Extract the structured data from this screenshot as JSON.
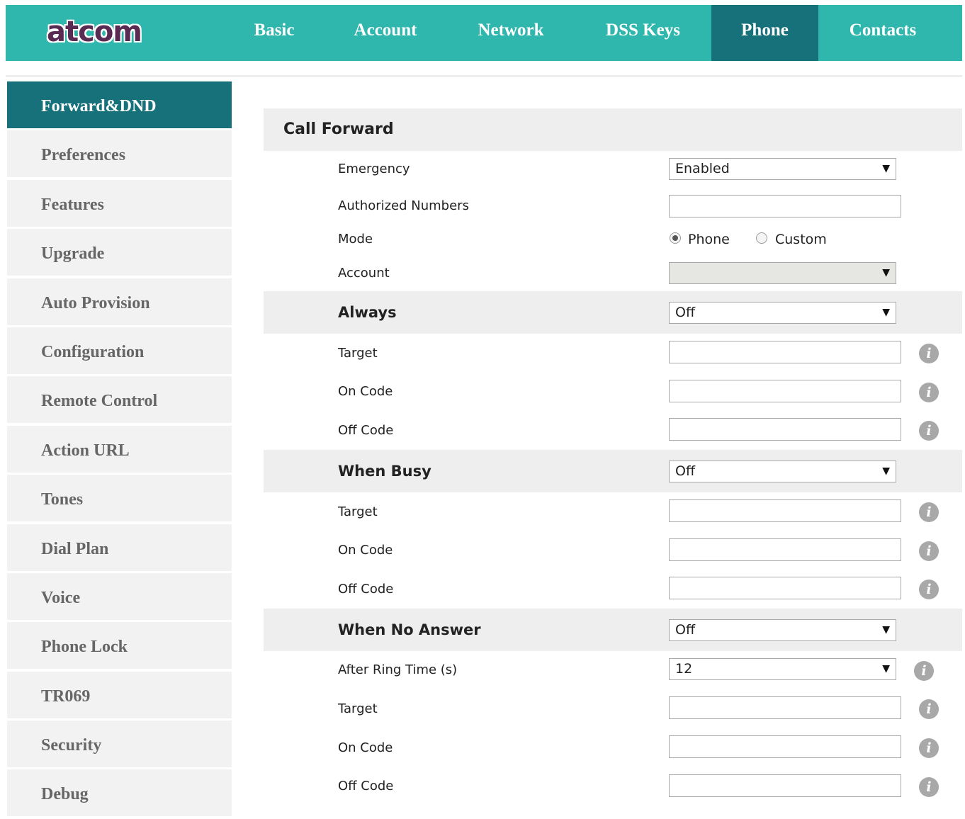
{
  "brand": {
    "logo_text": "atcom"
  },
  "nav": {
    "items": [
      {
        "label": "Basic"
      },
      {
        "label": "Account"
      },
      {
        "label": "Network"
      },
      {
        "label": "DSS Keys"
      },
      {
        "label": "Phone",
        "active": true
      },
      {
        "label": "Contacts"
      }
    ]
  },
  "sidebar": {
    "items": [
      {
        "label": "Forward&DND",
        "active": true
      },
      {
        "label": "Preferences"
      },
      {
        "label": "Features"
      },
      {
        "label": "Upgrade"
      },
      {
        "label": "Auto Provision"
      },
      {
        "label": "Configuration"
      },
      {
        "label": "Remote Control"
      },
      {
        "label": "Action URL"
      },
      {
        "label": "Tones"
      },
      {
        "label": "Dial Plan"
      },
      {
        "label": "Voice"
      },
      {
        "label": "Phone Lock"
      },
      {
        "label": "TR069"
      },
      {
        "label": "Security"
      },
      {
        "label": "Debug"
      }
    ]
  },
  "call_forward": {
    "title": "Call Forward",
    "emergency": {
      "label": "Emergency",
      "value": "Enabled"
    },
    "authorized_numbers": {
      "label": "Authorized Numbers",
      "value": ""
    },
    "mode": {
      "label": "Mode",
      "options": [
        "Phone",
        "Custom"
      ],
      "selected": "Phone"
    },
    "account": {
      "label": "Account",
      "value": ""
    },
    "always": {
      "label": "Always",
      "value": "Off",
      "target_label": "Target",
      "on_code_label": "On Code",
      "off_code_label": "Off Code"
    },
    "when_busy": {
      "label": "When Busy",
      "value": "Off",
      "target_label": "Target",
      "on_code_label": "On Code",
      "off_code_label": "Off Code"
    },
    "when_no_answer": {
      "label": "When No Answer",
      "value": "Off",
      "ring_time_label": "After Ring Time (s)",
      "ring_time_value": "12",
      "target_label": "Target",
      "on_code_label": "On Code",
      "off_code_label": "Off Code"
    }
  },
  "icons": {
    "info": "info-icon",
    "dropdown": "chevron-down-icon",
    "select_arrow_glyph": "▼",
    "info_glyph": "i"
  },
  "colors": {
    "brand_teal": "#2fb6ad",
    "active_teal": "#16717a",
    "section_gray": "#eeeeee",
    "sidebar_gray": "#f2f2f2"
  }
}
